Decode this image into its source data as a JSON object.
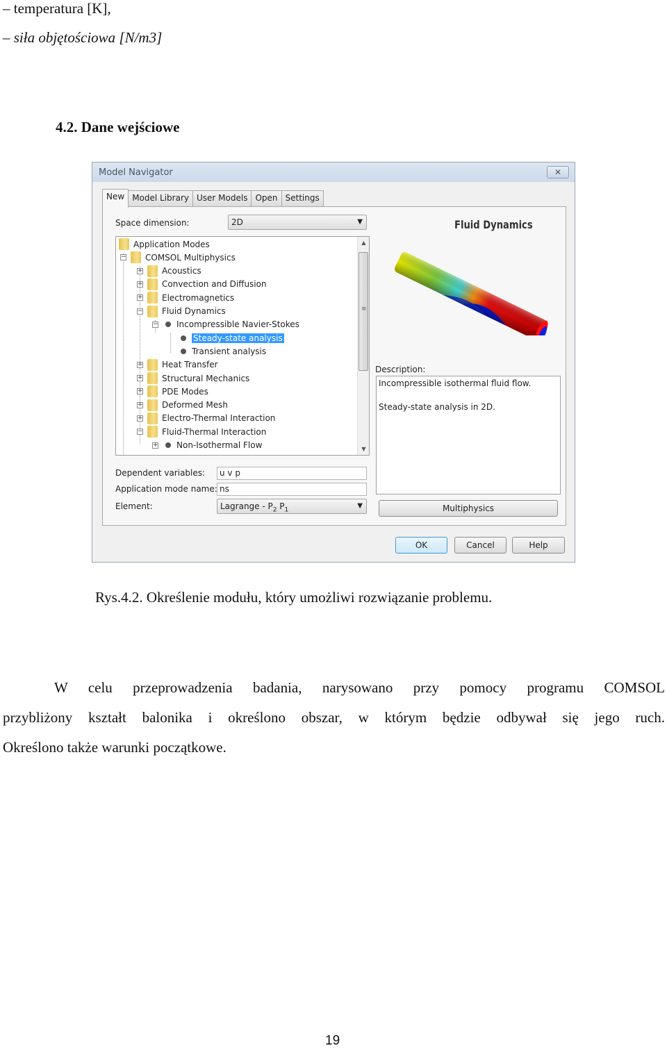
{
  "document": {
    "bullets": [
      "– temperatura [K],",
      "– siła objętościowa [N/m3]"
    ],
    "section_heading": "4.2. Dane wejściowe",
    "figure_caption": "Rys.4.2. Określenie modułu, który umożliwi rozwiązanie problemu.",
    "paragraph_lines": [
      "W celu przeprowadzenia badania, narysowano przy pomocy programu COMSOL",
      "przybliżony kształt balonika i określono obszar, w którym będzie odbywał się jego ruch.",
      "Określono także warunki początkowe."
    ],
    "page_number": "19"
  },
  "dialog": {
    "title": "Model Navigator",
    "close_icon": "✕",
    "tabs": [
      {
        "label": "New",
        "active": true
      },
      {
        "label": "Model Library",
        "active": false
      },
      {
        "label": "User Models",
        "active": false
      },
      {
        "label": "Open",
        "active": false
      },
      {
        "label": "Settings",
        "active": false
      }
    ],
    "space_dimension_label": "Space dimension:",
    "space_dimension_value": "2D",
    "dropdown_arrow": "▼",
    "tree": [
      {
        "label": "Application Modes",
        "level": 0,
        "type": "folder",
        "toggle": ""
      },
      {
        "label": "COMSOL Multiphysics",
        "level": 1,
        "type": "folder",
        "toggle": "−"
      },
      {
        "label": "Acoustics",
        "level": 2,
        "type": "folder",
        "toggle": "+"
      },
      {
        "label": "Convection and Diffusion",
        "level": 2,
        "type": "folder",
        "toggle": "+"
      },
      {
        "label": "Electromagnetics",
        "level": 2,
        "type": "folder",
        "toggle": "+"
      },
      {
        "label": "Fluid Dynamics",
        "level": 2,
        "type": "folder",
        "toggle": "−"
      },
      {
        "label": "Incompressible Navier-Stokes",
        "level": 3,
        "type": "mode",
        "toggle": "−"
      },
      {
        "label": "Steady-state analysis",
        "level": 4,
        "type": "mode",
        "toggle": "",
        "selected": true
      },
      {
        "label": "Transient analysis",
        "level": 4,
        "type": "mode",
        "toggle": ""
      },
      {
        "label": "Heat Transfer",
        "level": 2,
        "type": "folder",
        "toggle": "+"
      },
      {
        "label": "Structural Mechanics",
        "level": 2,
        "type": "folder",
        "toggle": "+"
      },
      {
        "label": "PDE Modes",
        "level": 2,
        "type": "folder",
        "toggle": "+"
      },
      {
        "label": "Deformed Mesh",
        "level": 2,
        "type": "folder",
        "toggle": "+"
      },
      {
        "label": "Electro-Thermal Interaction",
        "level": 2,
        "type": "folder",
        "toggle": "+"
      },
      {
        "label": "Fluid-Thermal Interaction",
        "level": 2,
        "type": "folder",
        "toggle": "−"
      },
      {
        "label": "Non-Isothermal Flow",
        "level": 3,
        "type": "mode",
        "toggle": "+"
      }
    ],
    "scroll_up": "▲",
    "scroll_down": "▼",
    "preview_title": "Fluid Dynamics",
    "description_label": "Description:",
    "description_lines": [
      "Incompressible isothermal fluid flow.",
      "",
      "Steady-state analysis in 2D."
    ],
    "dependent_variables_label": "Dependent variables:",
    "dependent_variables_value": "u v p",
    "app_mode_name_label": "Application mode name:",
    "app_mode_name_value": "ns",
    "element_label": "Element:",
    "element_value": "Lagrange - P",
    "element_sub1": "2",
    "element_mid": " P",
    "element_sub2": "1",
    "multiphysics_button": "Multiphysics",
    "ok_button": "OK",
    "cancel_button": "Cancel",
    "help_button": "Help"
  }
}
